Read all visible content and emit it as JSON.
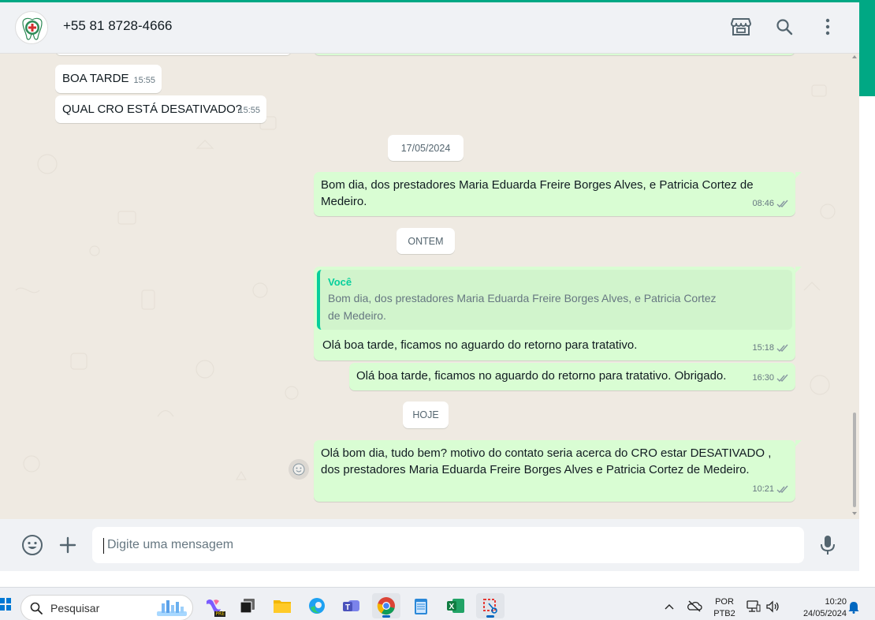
{
  "header": {
    "contact_name": "+55 81 8728-4666"
  },
  "icons": {
    "store": "store-icon",
    "search": "search-icon",
    "menu": "more-vertical-icon"
  },
  "messages": {
    "m1": {
      "text": "BOA TARDE",
      "time": "15:55"
    },
    "m2": {
      "text": "QUAL CRO ESTÁ DESATIVADO?",
      "time": "15:55"
    },
    "date1": "17/05/2024",
    "m3": {
      "text": "Bom dia, dos prestadores Maria Eduarda Freire Borges Alves, e Patricia Cortez de Medeiro.",
      "time": "08:46"
    },
    "date2": "ONTEM",
    "m4": {
      "quote_author": "Você",
      "quote_text": "Bom dia, dos prestadores Maria Eduarda Freire Borges Alves, e Patricia Cortez de Medeiro.",
      "text": "Olá boa tarde, ficamos no aguardo do retorno para tratativo.",
      "time": "15:18"
    },
    "m5": {
      "text": "Olá boa tarde, ficamos no aguardo do retorno para tratativo. Obrigado.",
      "time": "16:30"
    },
    "date3": "HOJE",
    "m6": {
      "text": "Olá bom dia, tudo bem? motivo do contato seria acerca do CRO estar DESATIVADO , dos prestadores Maria Eduarda Freire Borges Alves e Patricia Cortez de Medeiro.",
      "time": "10:21"
    }
  },
  "composer": {
    "placeholder": "Digite uma mensagem"
  },
  "taskbar": {
    "search_label": "Pesquisar",
    "lang_top": "POR",
    "lang_bottom": "PTB2",
    "time": "10:20",
    "date": "24/05/2024"
  },
  "colors": {
    "accent": "#00a884",
    "outgoing_bubble": "#d9fdd3",
    "incoming_bubble": "#ffffff",
    "chat_bg": "#efeae2"
  }
}
